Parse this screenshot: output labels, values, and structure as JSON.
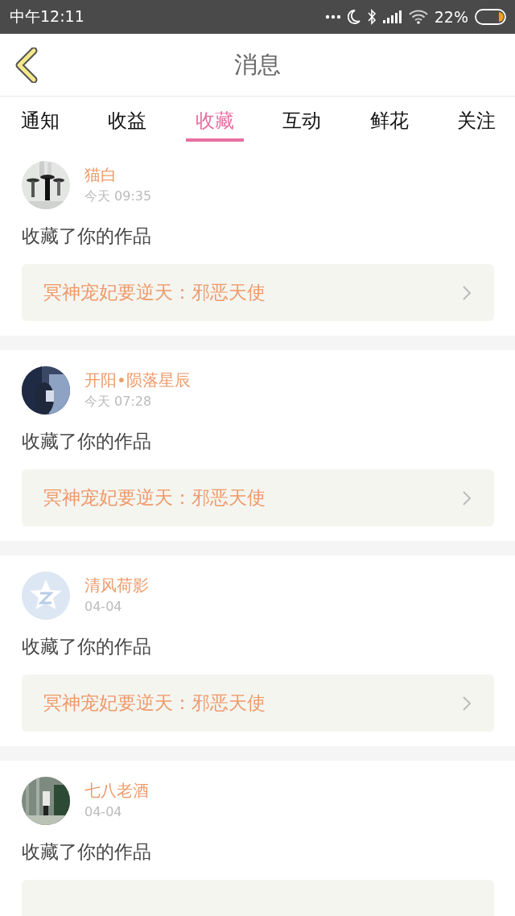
{
  "status_bar": {
    "time": "中午12:11",
    "battery": "22%"
  },
  "header": {
    "title": "消息"
  },
  "tabs": [
    {
      "label": "通知",
      "selected": false
    },
    {
      "label": "收益",
      "selected": false
    },
    {
      "label": "收藏",
      "selected": true
    },
    {
      "label": "互动",
      "selected": false
    },
    {
      "label": "鲜花",
      "selected": false
    },
    {
      "label": "关注",
      "selected": false
    }
  ],
  "messages": [
    {
      "name": "猫白",
      "time": "今天 09:35",
      "text": "收藏了你的作品",
      "work": "冥神宠妃要逆天：邪恶天使"
    },
    {
      "name": "开阳•陨落星辰",
      "time": "今天 07:28",
      "text": "收藏了你的作品",
      "work": "冥神宠妃要逆天：邪恶天使"
    },
    {
      "avatar": {
        "kind": "default"
      },
      "name": "清风荷影",
      "time": "04-04",
      "text": "收藏了你的作品",
      "work": "冥神宠妃要逆天：邪恶天使"
    },
    {
      "name": "七八老酒",
      "time": "04-04",
      "text": "收藏了你的作品"
    }
  ]
}
